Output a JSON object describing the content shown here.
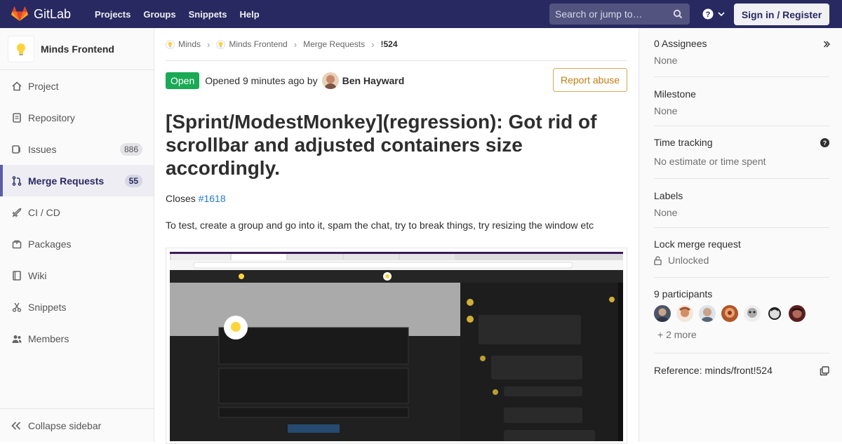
{
  "topbar": {
    "brand": "GitLab",
    "nav": [
      "Projects",
      "Groups",
      "Snippets",
      "Help"
    ],
    "search_placeholder": "Search or jump to…",
    "sign_in": "Sign in / Register",
    "brand_color": "#292961"
  },
  "sidebar": {
    "project_name": "Minds Frontend",
    "items": [
      {
        "label": "Project",
        "icon": "home-icon"
      },
      {
        "label": "Repository",
        "icon": "doc-icon"
      },
      {
        "label": "Issues",
        "icon": "issues-icon",
        "count": "886"
      },
      {
        "label": "Merge Requests",
        "icon": "merge-icon",
        "count": "55",
        "active": true
      },
      {
        "label": "CI / CD",
        "icon": "rocket-icon"
      },
      {
        "label": "Packages",
        "icon": "package-icon"
      },
      {
        "label": "Wiki",
        "icon": "book-icon"
      },
      {
        "label": "Snippets",
        "icon": "scissors-icon"
      },
      {
        "label": "Members",
        "icon": "users-icon"
      }
    ],
    "collapse": "Collapse sidebar"
  },
  "breadcrumbs": [
    "Minds",
    "Minds Frontend",
    "Merge Requests",
    "!524"
  ],
  "mr": {
    "status": "Open",
    "opened": "Opened 9 minutes ago by",
    "author": "Ben Hayward",
    "report": "Report abuse",
    "title": "[Sprint/ModestMonkey](regression): Got rid of scrollbar and adjusted containers size accordingly.",
    "closes_prefix": "Closes",
    "closes_link": "#1618",
    "description": "To test, create a group and go into it, spam the chat, try to break things, try resizing the window etc"
  },
  "right": {
    "assignees_label": "0 Assignees",
    "assignees_val": "None",
    "milestone_label": "Milestone",
    "milestone_val": "None",
    "time_label": "Time tracking",
    "time_val": "No estimate or time spent",
    "labels_label": "Labels",
    "labels_val": "None",
    "lock_label": "Lock merge request",
    "lock_val": "Unlocked",
    "participants_label": "9 participants",
    "participants_more": "+ 2 more",
    "reference": "Reference: minds/front!524"
  }
}
